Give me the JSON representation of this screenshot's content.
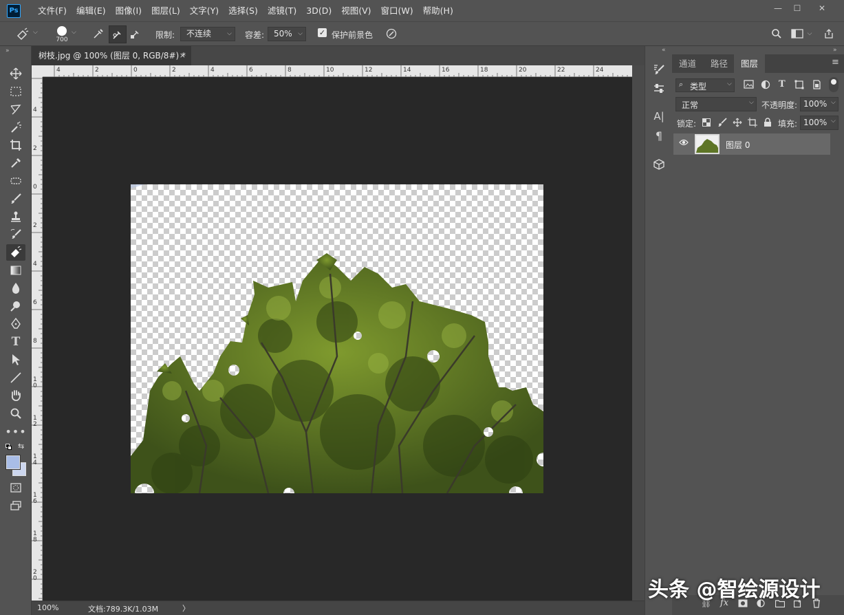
{
  "app": {
    "name": "Ps",
    "brand_color": "#31a8ff"
  },
  "menu": [
    "文件(F)",
    "编辑(E)",
    "图像(I)",
    "图层(L)",
    "文字(Y)",
    "选择(S)",
    "滤镜(T)",
    "3D(D)",
    "视图(V)",
    "窗口(W)",
    "帮助(H)"
  ],
  "window_controls": {
    "minimize": "—",
    "maximize": "☐",
    "close": "✕"
  },
  "options": {
    "brush_size": "700",
    "limit_label": "限制:",
    "limit_value": "不连续",
    "tolerance_label": "容差:",
    "tolerance_value": "50%",
    "protect_label": "保护前景色",
    "protect_checked": true
  },
  "document": {
    "tab_title": "树枝.jpg @ 100% (图层 0, RGB/8#) *",
    "close": "×",
    "zoom": "100%",
    "doc_info": "文档:789.3K/1.03M",
    "status_arrow": "〉"
  },
  "rulers": {
    "top": [
      "4",
      "2",
      "0",
      "2",
      "4",
      "6",
      "8",
      "10",
      "12",
      "14",
      "16",
      "18",
      "20",
      "22",
      "24"
    ],
    "left": [
      "4",
      "2",
      "0",
      "2",
      "4",
      "6",
      "8",
      "1\n0",
      "1\n2",
      "1\n4",
      "1\n6",
      "1\n8",
      "2\n0"
    ]
  },
  "toolbar": {
    "tools": [
      "move-tool",
      "marquee-tool",
      "lasso-tool",
      "magic-wand-tool",
      "crop-tool",
      "eyedropper-tool",
      "patch-tool",
      "brush-tool",
      "clone-stamp-tool",
      "history-brush-tool",
      "background-eraser-tool",
      "gradient-tool",
      "blur-tool",
      "dodge-tool",
      "pen-tool",
      "type-tool",
      "path-selection-tool",
      "line-tool",
      "hand-tool",
      "zoom-tool",
      "more-tools"
    ],
    "active_tool": "background-eraser-tool",
    "foreground_color": "#a9bde6",
    "background_color": "#ccd6ee"
  },
  "panels": {
    "tabs": [
      "通道",
      "路径",
      "图层"
    ],
    "active_tab": "图层",
    "filter_kind": "类型",
    "blend_mode": "正常",
    "opacity_label": "不透明度:",
    "opacity_value": "100%",
    "lock_label": "锁定:",
    "fill_label": "填充:",
    "fill_value": "100%",
    "layers": [
      {
        "name": "图层 0",
        "visible": true
      }
    ]
  },
  "watermark": "头条 @智绘源设计"
}
